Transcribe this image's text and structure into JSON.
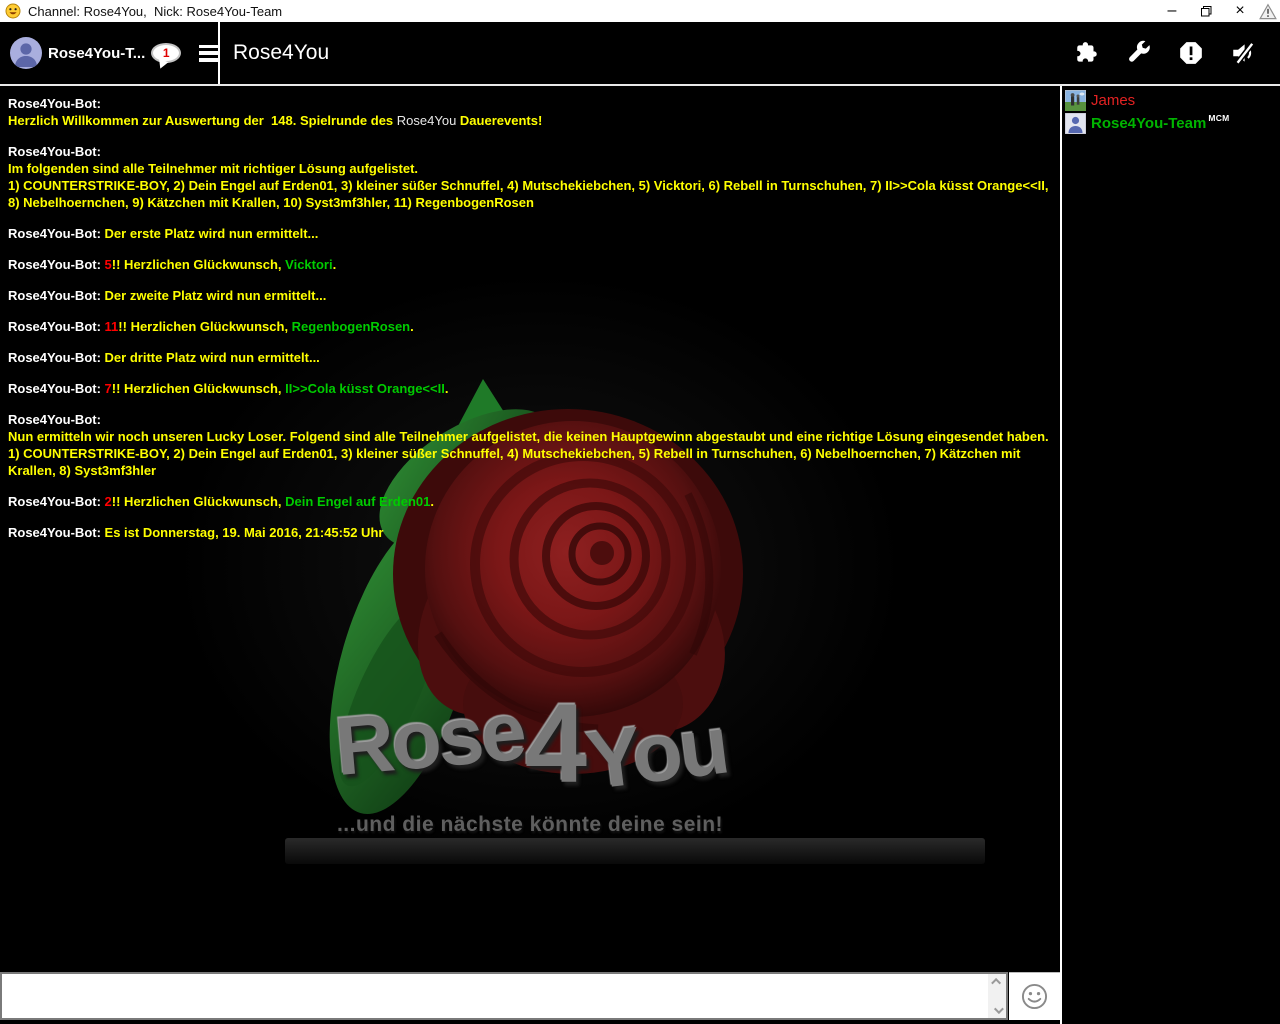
{
  "titlebar": {
    "title": "Channel: Rose4You,  Nick: Rose4You-Team",
    "minimize_glyph": "–",
    "close_glyph": "×"
  },
  "header": {
    "user_button_label": "Rose4You-T...",
    "unread_badge": "1",
    "channel_title": "Rose4You"
  },
  "chat": {
    "colors": {
      "yellow": "#ffff00",
      "red": "#ff0000",
      "green": "#00cc00",
      "bot_name": "#ffffff"
    },
    "bot_name": "Rose4You-Bot",
    "messages": [
      [
        [
          {
            "s": "n",
            "t": "Rose4You-Bot:"
          }
        ],
        [
          {
            "s": "y",
            "t": "Herzlich Willkommen zur Auswertung der  148. Spielrunde des "
          },
          {
            "s": "w",
            "t": "Rose4You"
          },
          {
            "s": "y",
            "t": " Dauerevents!"
          }
        ]
      ],
      [
        [
          {
            "s": "n",
            "t": "Rose4You-Bot:"
          }
        ],
        [
          {
            "s": "y",
            "t": "Im folgenden sind alle Teilnehmer mit richtiger Lösung aufgelistet."
          }
        ],
        [
          {
            "s": "y",
            "t": "1) COUNTERSTRIKE-BOY, 2) Dein Engel auf Erden01, 3) kleiner süßer Schnuffel, 4) Mutschekiebchen, 5) Vicktori, 6) Rebell in Turnschuhen, 7) II>>Cola küsst Orange<<II, 8) Nebelhoernchen, 9) Kätzchen mit Krallen, 10) Syst3mf3hler, 11) RegenbogenRosen"
          }
        ]
      ],
      [
        [
          {
            "s": "n",
            "t": "Rose4You-Bot: "
          },
          {
            "s": "y",
            "t": "Der erste Platz wird nun ermittelt..."
          }
        ]
      ],
      [
        [
          {
            "s": "n",
            "t": "Rose4You-Bot: "
          },
          {
            "s": "r",
            "t": "5"
          },
          {
            "s": "y",
            "t": "!! Herzlichen Glückwunsch, "
          },
          {
            "s": "g",
            "t": "Vicktori"
          },
          {
            "s": "y",
            "t": "."
          }
        ]
      ],
      [
        [
          {
            "s": "n",
            "t": "Rose4You-Bot: "
          },
          {
            "s": "y",
            "t": "Der zweite Platz wird nun ermittelt..."
          }
        ]
      ],
      [
        [
          {
            "s": "n",
            "t": "Rose4You-Bot: "
          },
          {
            "s": "r",
            "t": "11"
          },
          {
            "s": "y",
            "t": "!! Herzlichen Glückwunsch, "
          },
          {
            "s": "g",
            "t": "RegenbogenRosen"
          },
          {
            "s": "y",
            "t": "."
          }
        ]
      ],
      [
        [
          {
            "s": "n",
            "t": "Rose4You-Bot: "
          },
          {
            "s": "y",
            "t": "Der dritte Platz wird nun ermittelt..."
          }
        ]
      ],
      [
        [
          {
            "s": "n",
            "t": "Rose4You-Bot: "
          },
          {
            "s": "r",
            "t": "7"
          },
          {
            "s": "y",
            "t": "!! Herzlichen Glückwunsch, "
          },
          {
            "s": "g",
            "t": "II>>Cola küsst Orange<<II"
          },
          {
            "s": "y",
            "t": "."
          }
        ]
      ],
      [
        [
          {
            "s": "n",
            "t": "Rose4You-Bot:"
          }
        ],
        [
          {
            "s": "y",
            "t": "Nun ermitteln wir noch unseren Lucky Loser. Folgend sind alle Teilnehmer aufgelistet, die keinen Hauptgewinn abgestaubt und eine richtige Lösung eingesendet haben."
          }
        ],
        [
          {
            "s": "y",
            "t": "1) COUNTERSTRIKE-BOY, 2) Dein Engel auf Erden01, 3) kleiner süßer Schnuffel, 4) Mutschekiebchen, 5) Rebell in Turnschuhen, 6) Nebelhoernchen, 7) Kätzchen mit Krallen, 8) Syst3mf3hler"
          }
        ]
      ],
      [
        [
          {
            "s": "n",
            "t": "Rose4You-Bot: "
          },
          {
            "s": "r",
            "t": "2"
          },
          {
            "s": "y",
            "t": "!! Herzlichen Glückwunsch, "
          },
          {
            "s": "g",
            "t": "Dein Engel auf Erden01"
          },
          {
            "s": "y",
            "t": "."
          }
        ]
      ],
      [
        [
          {
            "s": "n",
            "t": "Rose4You-Bot: "
          },
          {
            "s": "y",
            "t": "Es ist Donnerstag, 19. Mai 2016, 21:45:52 Uhr"
          }
        ]
      ]
    ]
  },
  "background_logo": {
    "part1": "Rose",
    "part2": "4",
    "part3": "You",
    "tagline": "...und die nächste könnte deine sein!"
  },
  "sidebar": {
    "users": [
      {
        "name": "James",
        "color": "#e32222",
        "avatar": "photo-avatar"
      },
      {
        "name": "Rose4You-Team",
        "color": "#00b400",
        "badge": "MCM",
        "avatar": "person-avatar"
      }
    ]
  },
  "composer": {
    "value": "",
    "placeholder": ""
  }
}
